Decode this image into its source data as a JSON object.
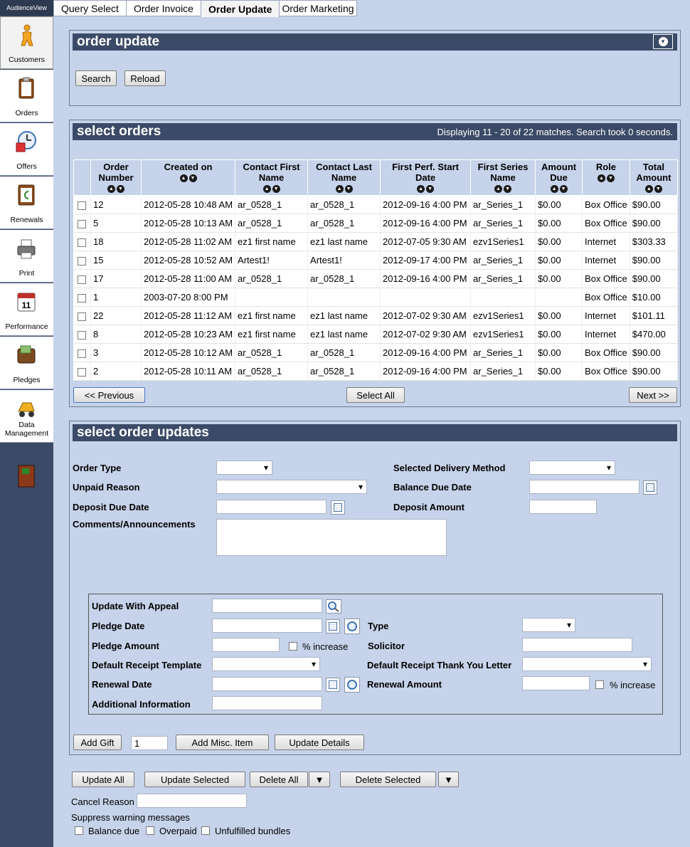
{
  "brand": "AudienceView",
  "tabs": [
    "Query Select",
    "Order Invoice",
    "Order Update",
    "Order Marketing"
  ],
  "sidebar": {
    "items": [
      {
        "label": "Customers",
        "icon": "person-icon"
      },
      {
        "label": "Orders",
        "icon": "clipboard-icon"
      },
      {
        "label": "Offers",
        "icon": "clock-gift-icon"
      },
      {
        "label": "Renewals",
        "icon": "renewal-icon"
      },
      {
        "label": "Print",
        "icon": "printer-icon"
      },
      {
        "label": "Performance",
        "icon": "calendar-icon"
      },
      {
        "label": "Pledges",
        "icon": "wallet-icon"
      },
      {
        "label": "Data Management",
        "icon": "loader-icon"
      }
    ],
    "calendar_day": "11"
  },
  "order_update": {
    "title": "order update",
    "search_label": "Search",
    "reload_label": "Reload"
  },
  "select_orders": {
    "title": "select orders",
    "status": "Displaying 11 - 20 of 22 matches. Search took 0 seconds.",
    "columns": [
      "Order Number",
      "Created on",
      "Contact First Name",
      "Contact Last Name",
      "First Perf. Start Date",
      "First Series Name",
      "Amount Due",
      "Role",
      "Total Amount"
    ],
    "rows": [
      [
        "12",
        "2012-05-28 10:48 AM",
        "ar_0528_1",
        "ar_0528_1",
        "2012-09-16 4:00 PM",
        "ar_Series_1",
        "$0.00",
        "Box Office",
        "$90.00"
      ],
      [
        "5",
        "2012-05-28 10:13 AM",
        "ar_0528_1",
        "ar_0528_1",
        "2012-09-16 4:00 PM",
        "ar_Series_1",
        "$0.00",
        "Box Office",
        "$90.00"
      ],
      [
        "18",
        "2012-05-28 11:02 AM",
        "ez1 first name",
        "ez1 last name",
        "2012-07-05 9:30 AM",
        "ezv1Series1",
        "$0.00",
        "Internet",
        "$303.33"
      ],
      [
        "15",
        "2012-05-28 10:52 AM",
        "Artest1!",
        "Artest1!",
        "2012-09-17 4:00 PM",
        "ar_Series_1",
        "$0.00",
        "Internet",
        "$90.00"
      ],
      [
        "17",
        "2012-05-28 11:00 AM",
        "ar_0528_1",
        "ar_0528_1",
        "2012-09-16 4:00 PM",
        "ar_Series_1",
        "$0.00",
        "Box Office",
        "$90.00"
      ],
      [
        "1",
        "2003-07-20 8:00 PM",
        "",
        "",
        "",
        "",
        "",
        "Box Office",
        "$10.00"
      ],
      [
        "22",
        "2012-05-28 11:12 AM",
        "ez1 first name",
        "ez1 last name",
        "2012-07-02 9:30 AM",
        "ezv1Series1",
        "$0.00",
        "Internet",
        "$101.11"
      ],
      [
        "8",
        "2012-05-28 10:23 AM",
        "ez1 first name",
        "ez1 last name",
        "2012-07-02 9:30 AM",
        "ezv1Series1",
        "$0.00",
        "Internet",
        "$470.00"
      ],
      [
        "3",
        "2012-05-28 10:12 AM",
        "ar_0528_1",
        "ar_0528_1",
        "2012-09-16 4:00 PM",
        "ar_Series_1",
        "$0.00",
        "Box Office",
        "$90.00"
      ],
      [
        "2",
        "2012-05-28 10:11 AM",
        "ar_0528_1",
        "ar_0528_1",
        "2012-09-16 4:00 PM",
        "ar_Series_1",
        "$0.00",
        "Box Office",
        "$90.00"
      ]
    ],
    "previous_label": "<< Previous",
    "select_all_label": "Select All",
    "next_label": "Next >>"
  },
  "select_order_updates": {
    "title": "select order updates",
    "order_type_label": "Order Type",
    "unpaid_reason_label": "Unpaid Reason",
    "deposit_due_date_label": "Deposit Due Date",
    "comments_label": "Comments/Announcements",
    "delivery_method_label": "Selected Delivery Method",
    "balance_due_date_label": "Balance Due Date",
    "deposit_amount_label": "Deposit Amount",
    "gift": {
      "appeal_label": "Update With Appeal",
      "pledge_date_label": "Pledge Date",
      "pledge_amount_label": "Pledge Amount",
      "pct_increase_label": "% increase",
      "receipt_template_label": "Default Receipt Template",
      "renewal_date_label": "Renewal Date",
      "additional_info_label": "Additional Information",
      "type_label": "Type",
      "solicitor_label": "Solicitor",
      "thank_you_letter_label": "Default Receipt Thank You Letter",
      "renewal_amount_label": "Renewal Amount",
      "renewal_pct_increase_label": "% increase"
    },
    "add_gift_label": "Add Gift",
    "quantity_value": "1",
    "add_misc_label": "Add Misc. Item",
    "update_details_label": "Update Details"
  },
  "footer": {
    "update_all_label": "Update All",
    "update_selected_label": "Update Selected",
    "delete_all_label": "Delete All",
    "delete_selected_label": "Delete Selected",
    "cancel_reason_label": "Cancel Reason",
    "suppress_label": "Suppress warning messages",
    "balance_due_label": "Balance due",
    "overpaid_label": "Overpaid",
    "unfulfilled_label": "Unfulfilled bundles"
  }
}
